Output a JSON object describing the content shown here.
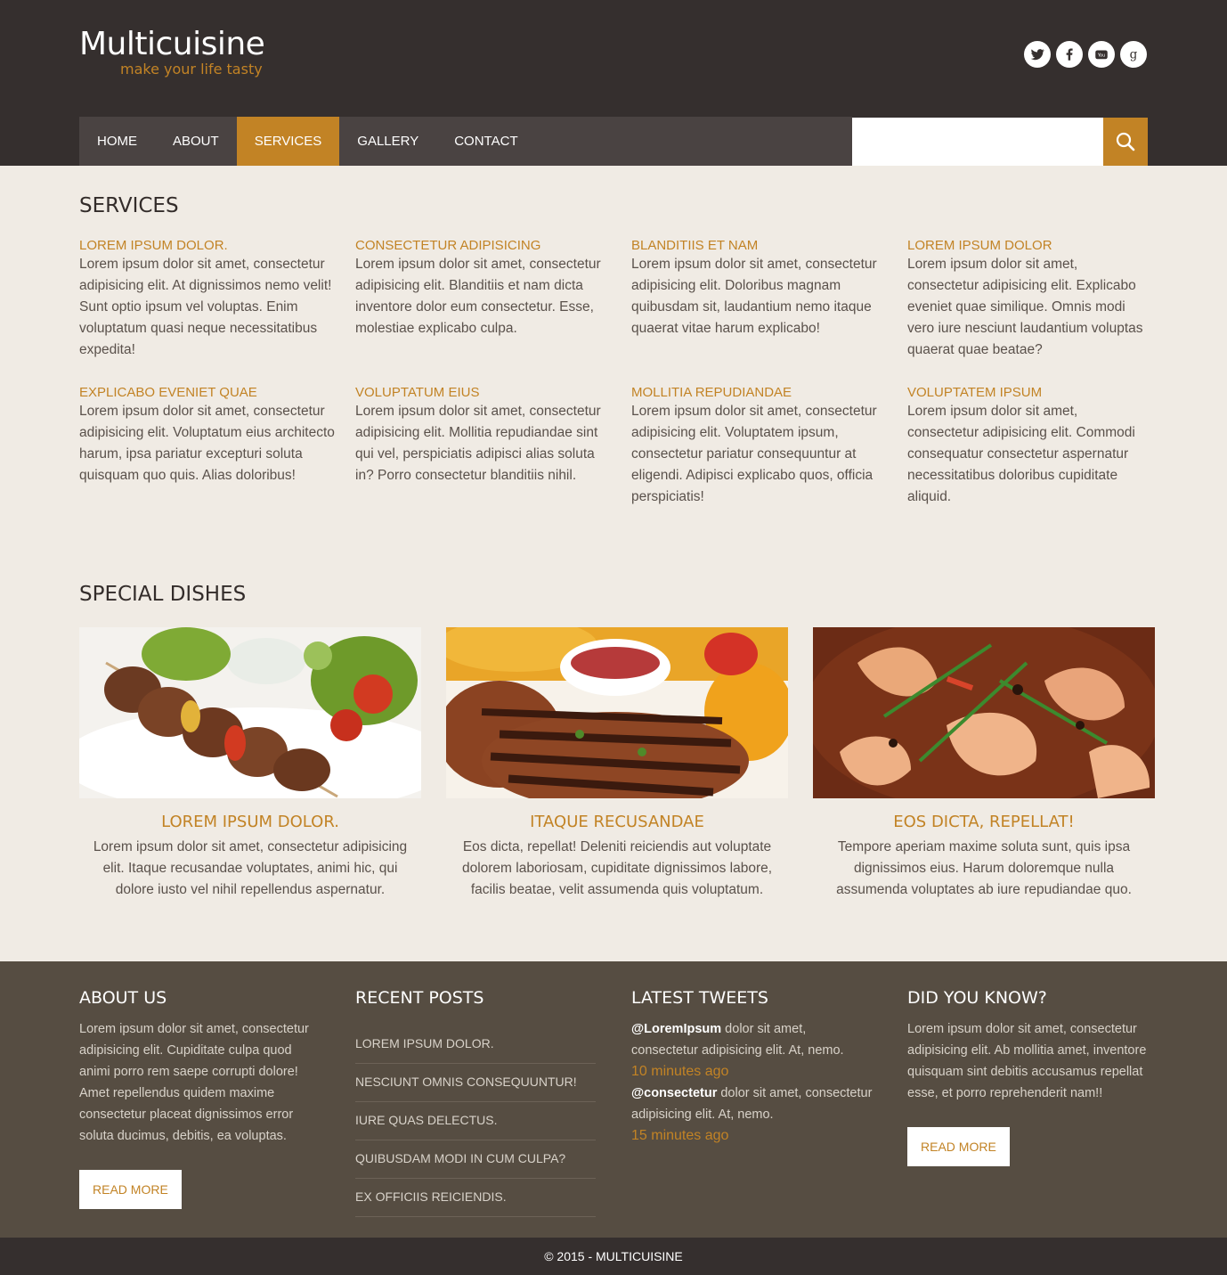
{
  "brand": {
    "name": "Multicuisine",
    "tagline": "make your life tasty"
  },
  "socials": [
    {
      "icon": "twitter-icon"
    },
    {
      "icon": "facebook-icon"
    },
    {
      "icon": "youtube-icon"
    },
    {
      "icon": "google-plus-icon"
    }
  ],
  "nav": [
    "HOME",
    "ABOUT",
    "SERVICES",
    "GALLERY",
    "CONTACT"
  ],
  "nav_active": "SERVICES",
  "search": {
    "value": "",
    "icon": "search-icon"
  },
  "services": {
    "title": "SERVICES",
    "items": [
      {
        "title": "LOREM IPSUM DOLOR.",
        "text": "Lorem ipsum dolor sit amet, consectetur adipisicing elit. At dignissimos nemo velit! Sunt optio ipsum vel voluptas. Enim voluptatum quasi neque necessitatibus expedita!"
      },
      {
        "title": "CONSECTETUR ADIPISICING",
        "text": "Lorem ipsum dolor sit amet, consectetur adipisicing elit. Blanditiis et nam dicta inventore dolor eum consectetur. Esse, molestiae explicabo culpa."
      },
      {
        "title": "BLANDITIIS ET NAM",
        "text": "Lorem ipsum dolor sit amet, consectetur adipisicing elit. Doloribus magnam quibusdam sit, laudantium nemo itaque quaerat vitae harum explicabo!"
      },
      {
        "title": "LOREM IPSUM DOLOR",
        "text": "Lorem ipsum dolor sit amet, consectetur adipisicing elit. Explicabo eveniet quae similique. Omnis modi vero iure nesciunt laudantium voluptas quaerat quae beatae?"
      },
      {
        "title": "EXPLICABO EVENIET QUAE",
        "text": "Lorem ipsum dolor sit amet, consectetur adipisicing elit. Voluptatum eius architecto harum, ipsa pariatur excepturi soluta quisquam quo quis. Alias doloribus!"
      },
      {
        "title": "VOLUPTATUM EIUS",
        "text": "Lorem ipsum dolor sit amet, consectetur adipisicing elit. Mollitia repudiandae sint qui vel, perspiciatis adipisci alias soluta in? Porro consectetur blanditiis nihil."
      },
      {
        "title": "MOLLITIA REPUDIANDAE",
        "text": "Lorem ipsum dolor sit amet, consectetur adipisicing elit. Voluptatem ipsum, consectetur pariatur consequuntur at eligendi. Adipisci explicabo quos, officia perspiciatis!"
      },
      {
        "title": "VOLUPTATEM IPSUM",
        "text": "Lorem ipsum dolor sit amet, consectetur adipisicing elit. Commodi consequatur consectetur aspernatur necessitatibus doloribus cupiditate aliquid."
      }
    ]
  },
  "dishes": {
    "title": "SPECIAL DISHES",
    "items": [
      {
        "image": "kebab-skewers-salad-photo",
        "title": "LOREM IPSUM DOLOR.",
        "text": "Lorem ipsum dolor sit amet, consectetur adipisicing elit. Itaque recusandae voluptates, animi hic, qui dolore iusto vel nihil repellendus aspernatur."
      },
      {
        "image": "grilled-steak-ketchup-photo",
        "title": "ITAQUE RECUSANDAE",
        "text": "Eos dicta, repellat! Deleniti reiciendis aut voluptate dolorem laboriosam, cupiditate dignissimos labore, facilis beatae, velit assumenda quis voluptatum."
      },
      {
        "image": "shrimp-stir-fry-photo",
        "title": "EOS DICTA, REPELLAT!",
        "text": "Tempore aperiam maxime soluta sunt, quis ipsa dignissimos eius. Harum doloremque nulla assumenda voluptates ab iure repudiandae quo."
      }
    ]
  },
  "footer": {
    "about": {
      "title": "ABOUT US",
      "text": "Lorem ipsum dolor sit amet, consectetur adipisicing elit. Cupiditate culpa quod animi porro rem saepe corrupti dolore! Amet repellendus quidem maxime consectetur placeat dignissimos error soluta ducimus, debitis, ea voluptas.",
      "button": "READ MORE"
    },
    "recent_posts": {
      "title": "RECENT POSTS",
      "items": [
        "LOREM IPSUM DOLOR.",
        "NESCIUNT OMNIS CONSEQUUNTUR!",
        "IURE QUAS DELECTUS.",
        "QUIBUSDAM MODI IN CUM CULPA?",
        "EX OFFICIIS REICIENDIS."
      ]
    },
    "tweets": {
      "title": "LATEST TWEETS",
      "items": [
        {
          "handle": "@LoremIpsum",
          "text": " dolor sit amet, consectetur adipisicing elit. At, nemo.",
          "time": "10 minutes ago"
        },
        {
          "handle": "@consectetur",
          "text": " dolor sit amet, consectetur adipisicing elit. At, nemo.",
          "time": "15 minutes ago"
        }
      ]
    },
    "did_you_know": {
      "title": "DID YOU KNOW?",
      "text": "Lorem ipsum dolor sit amet, consectetur adipisicing elit. Ab mollitia amet, inventore quisquam sint debitis accusamus repellat esse, et porro reprehenderit nam!!",
      "button": "READ MORE"
    }
  },
  "copyright": "© 2015 - MULTICUISINE",
  "colors": {
    "accent": "#c28325",
    "header_bg": "#352f2e",
    "nav_bg": "#4a4342",
    "body_bg": "#f0ebe4",
    "footer_bg": "#564d42"
  }
}
